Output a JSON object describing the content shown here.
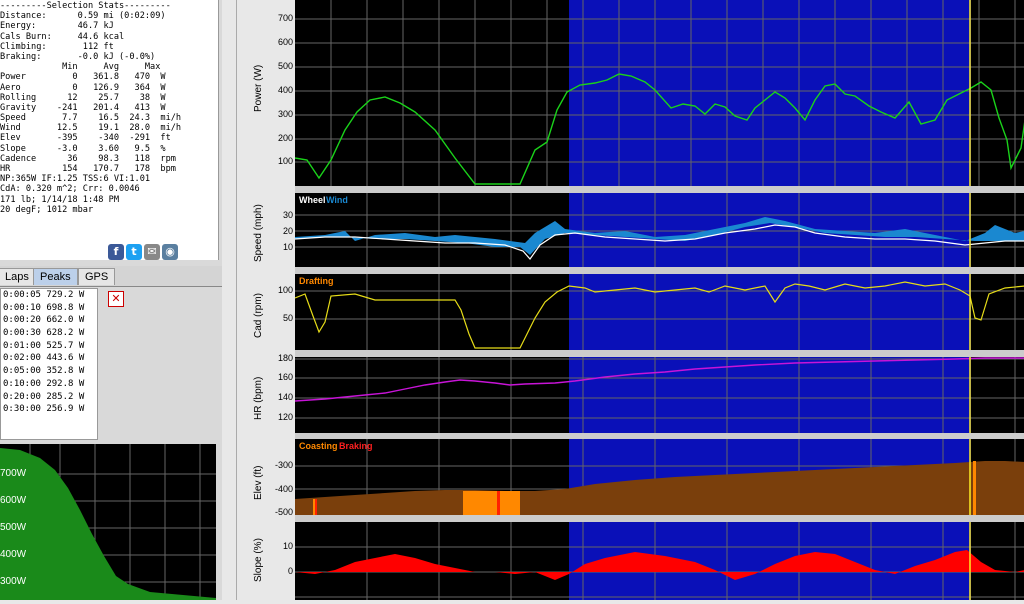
{
  "stats": {
    "lines": [
      "---------Selection Stats---------",
      "Distance:      0.59 mi (0:02:09)",
      "Energy:        46.7 kJ",
      "Cals Burn:     44.6 kcal",
      "Climbing:       112 ft",
      "Braking:       -0.0 kJ (-0.0%)",
      "            Min     Avg     Max",
      "Power         0   361.8   470  W",
      "Aero          0   126.9   364  W",
      "Rolling      12    25.7    38  W",
      "Gravity    -241   201.4   413  W",
      "Speed       7.7    16.5  24.3  mi/h",
      "Wind       12.5    19.1  28.0  mi/h",
      "Elev       -395    -340  -291  ft",
      "Slope      -3.0    3.60   9.5  %",
      "Cadence      36    98.3   118  rpm",
      "HR          154   170.7   178  bpm",
      "NP:365W IF:1.25 TSS:6 VI:1.01",
      "CdA: 0.320 m^2; Crr: 0.0046",
      "171 lb; 1/14/18 1:48 PM",
      "20 degF; 1012 mbar"
    ]
  },
  "social_icons": [
    "facebook-icon",
    "twitter-icon",
    "email-icon",
    "share-icon"
  ],
  "social_glyphs": [
    "f",
    "t",
    "✉",
    "◉"
  ],
  "tabs": [
    "Laps",
    "Peaks",
    "GPS"
  ],
  "peaks": [
    "0:00:05 729.2 W",
    "0:00:10 698.8 W",
    "0:00:20 662.0 W",
    "0:00:30 628.2 W",
    "0:01:00 525.7 W",
    "0:02:00 443.6 W",
    "0:05:00 352.8 W",
    "0:10:00 292.8 W",
    "0:20:00 285.2 W",
    "0:30:00 256.9 W"
  ],
  "close_glyph": "✕",
  "mini_labels": [
    "700W",
    "600W",
    "500W",
    "400W",
    "300W"
  ],
  "charts": {
    "power": {
      "ylabel": "Power (W)",
      "ticks": [
        "700",
        "600",
        "500",
        "400",
        "300",
        "200",
        "100"
      ]
    },
    "speed": {
      "ylabel": "Speed (mph)",
      "ticks": [
        "30",
        "20",
        "10"
      ],
      "legend_wheel": "Wheel",
      "legend_wind": "Wind"
    },
    "cad": {
      "ylabel": "Cad (rpm)",
      "ticks": [
        "100",
        "50"
      ],
      "legend": "Drafting"
    },
    "hr": {
      "ylabel": "HR (bpm)",
      "ticks": [
        "180",
        "160",
        "140",
        "120"
      ]
    },
    "elev": {
      "ylabel": "Elev (ft)",
      "ticks": [
        "-300",
        "-400",
        "-500"
      ],
      "legend_coast": "Coasting",
      "legend_brake": "Braking"
    },
    "slope": {
      "ylabel": "Slope (%)",
      "ticks": [
        "10",
        "0"
      ]
    }
  },
  "colors": {
    "selection": "#0a10b8",
    "power": "#1ad21a",
    "speed_area": "#1a88d0",
    "cad": "#e6dc18",
    "hr": "#c814d8",
    "elev": "#7a3f0c",
    "coast": "#ff8800",
    "slope": "#ff0000",
    "mini_fill": "#1a8a1a"
  }
}
